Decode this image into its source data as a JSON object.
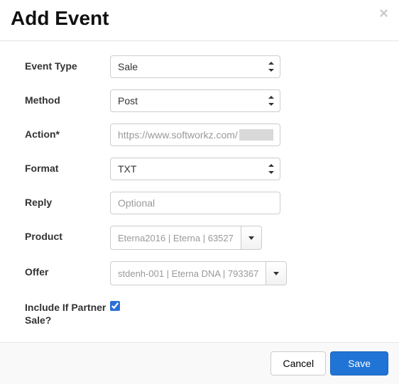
{
  "header": {
    "title": "Add Event",
    "close": "×"
  },
  "form": {
    "event_type": {
      "label": "Event Type",
      "value": "Sale"
    },
    "method": {
      "label": "Method",
      "value": "Post"
    },
    "action": {
      "label": "Action*",
      "value": "https://www.softworkz.com/"
    },
    "format": {
      "label": "Format",
      "value": "TXT"
    },
    "reply": {
      "label": "Reply",
      "placeholder": "Optional",
      "value": ""
    },
    "product": {
      "label": "Product",
      "value": "Eterna2016 | Eterna | 63527"
    },
    "offer": {
      "label": "Offer",
      "value": "stdenh-001 | Eterna DNA | 793367"
    },
    "include_if": {
      "label": "Include If Partner Sale?",
      "checked": true
    }
  },
  "footer": {
    "cancel": "Cancel",
    "save": "Save"
  }
}
